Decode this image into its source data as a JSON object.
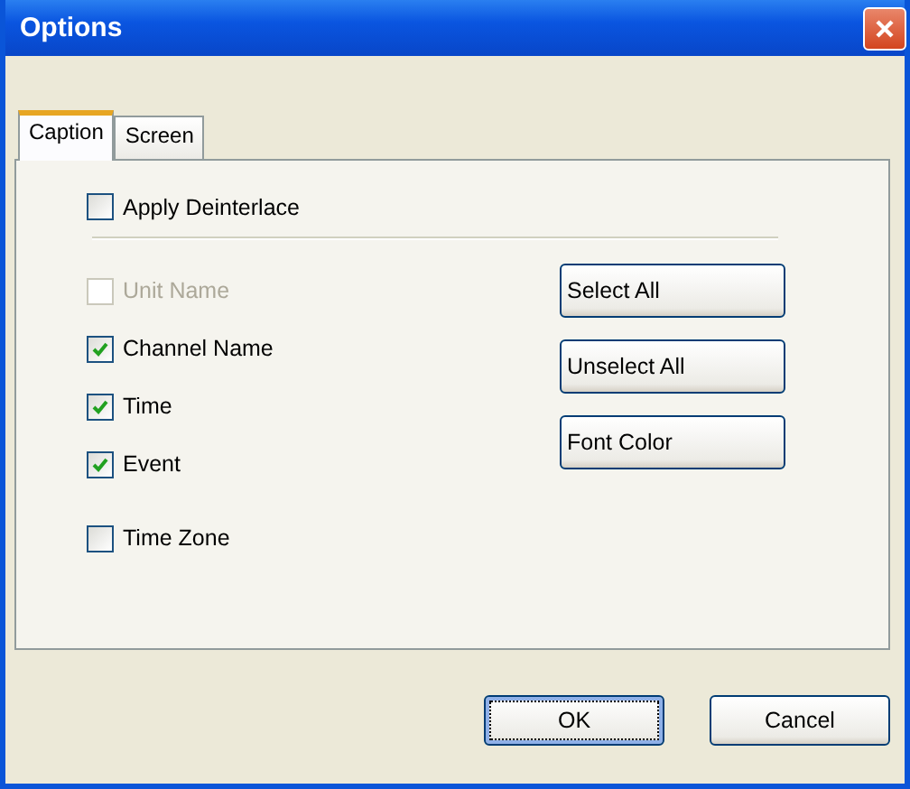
{
  "window": {
    "title": "Options"
  },
  "tabs": [
    {
      "label": "Caption",
      "selected": true
    },
    {
      "label": "Screen",
      "selected": false
    }
  ],
  "deinterlace": {
    "label": "Apply Deinterlace",
    "checked": false,
    "disabled": false
  },
  "caption_items": [
    {
      "label": "Unit Name",
      "checked": false,
      "disabled": true
    },
    {
      "label": "Channel Name",
      "checked": true,
      "disabled": false
    },
    {
      "label": "Time",
      "checked": true,
      "disabled": false
    },
    {
      "label": "Event",
      "checked": true,
      "disabled": false
    },
    {
      "label": "Time Zone",
      "checked": false,
      "disabled": false
    }
  ],
  "side_buttons": [
    "Select All",
    "Unselect All",
    "Font Color"
  ],
  "buttons": [
    {
      "label": "OK",
      "focused": true
    },
    {
      "label": "Cancel",
      "focused": false
    }
  ]
}
